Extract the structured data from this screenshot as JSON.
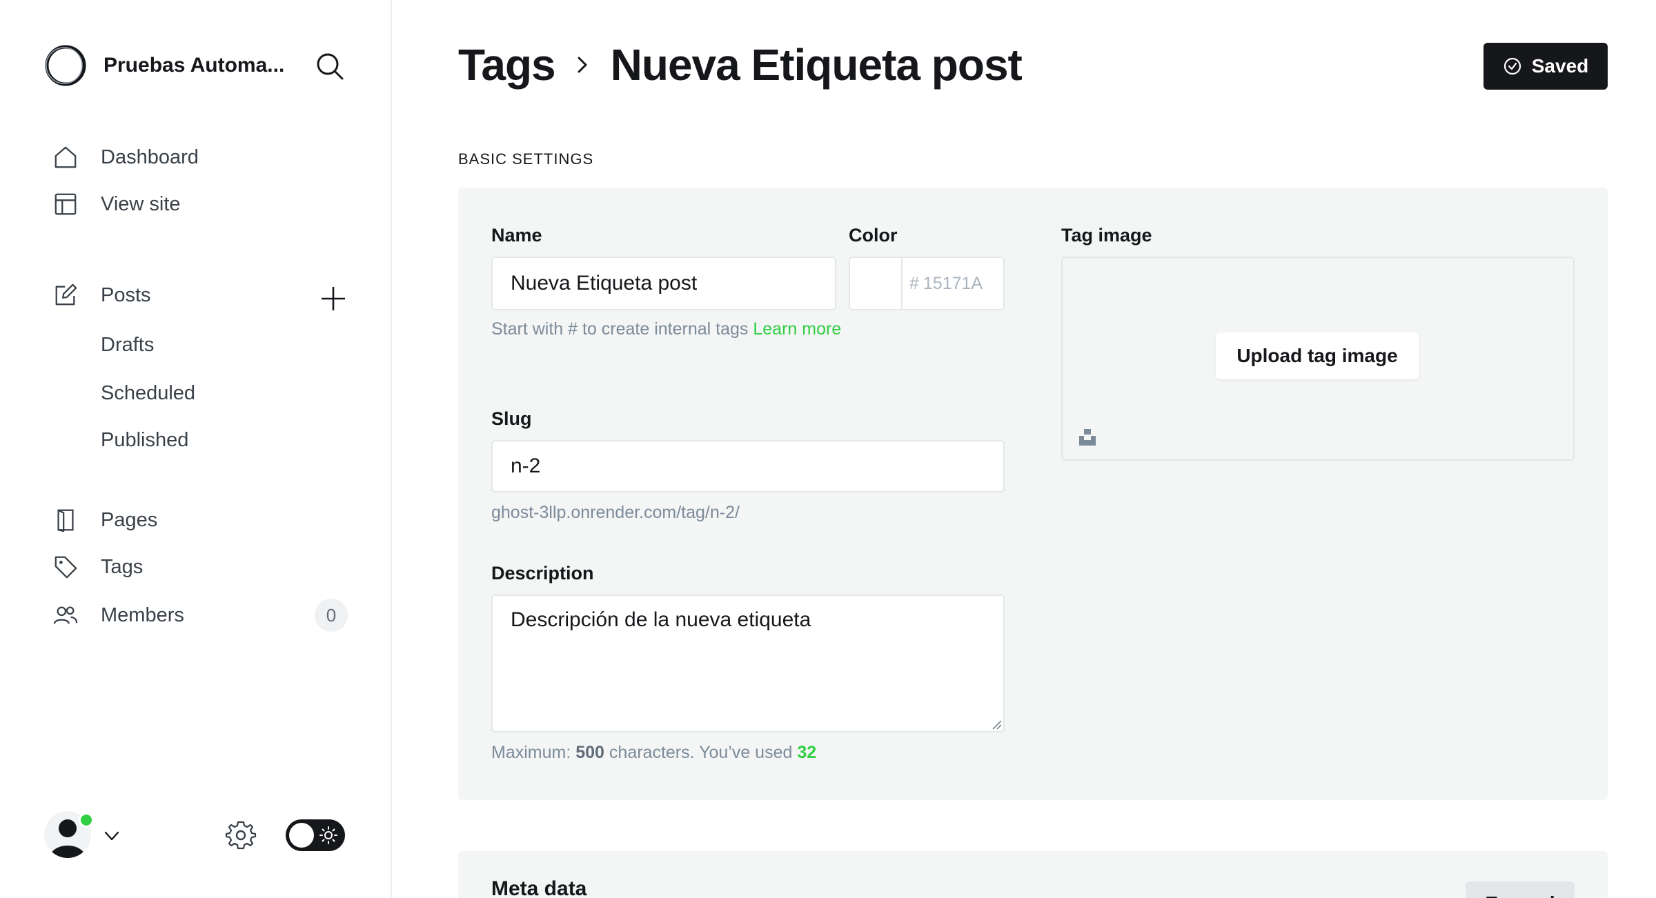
{
  "sidebar": {
    "site_title": "Pruebas Automa...",
    "nav": [
      {
        "label": "Dashboard",
        "icon": "home-icon"
      },
      {
        "label": "View site",
        "icon": "layout-icon"
      },
      {
        "label": "Posts",
        "icon": "edit-icon"
      },
      {
        "label": "Pages",
        "icon": "page-icon"
      },
      {
        "label": "Tags",
        "icon": "tag-icon"
      },
      {
        "label": "Members",
        "icon": "members-icon"
      }
    ],
    "posts_sub": [
      "Drafts",
      "Scheduled",
      "Published"
    ],
    "members_count": "0"
  },
  "header": {
    "breadcrumb_parent": "Tags",
    "title": "Nueva Etiqueta post",
    "saved_label": "Saved"
  },
  "basic_settings": {
    "section_title": "BASIC SETTINGS",
    "name_label": "Name",
    "name_value": "Nueva Etiqueta post",
    "name_hint": "Start with # to create internal tags",
    "learn_more": "Learn more",
    "color_label": "Color",
    "color_hash": "#",
    "color_placeholder": "15171A",
    "slug_label": "Slug",
    "slug_value": "n-2",
    "slug_url": "ghost-3llp.onrender.com/tag/n-2/",
    "description_label": "Description",
    "description_value": "Descripción de la nueva etiqueta",
    "desc_max_prefix": "Maximum:",
    "desc_max": "500",
    "desc_mid": "characters. You’ve used",
    "desc_used": "32",
    "tag_image_label": "Tag image",
    "upload_label": "Upload tag image"
  },
  "meta": {
    "title": "Meta data",
    "expand_label": "Expand"
  },
  "colors": {
    "accent_green": "#30cf43",
    "dark": "#15171a",
    "panel_bg": "#f4f5f5"
  }
}
